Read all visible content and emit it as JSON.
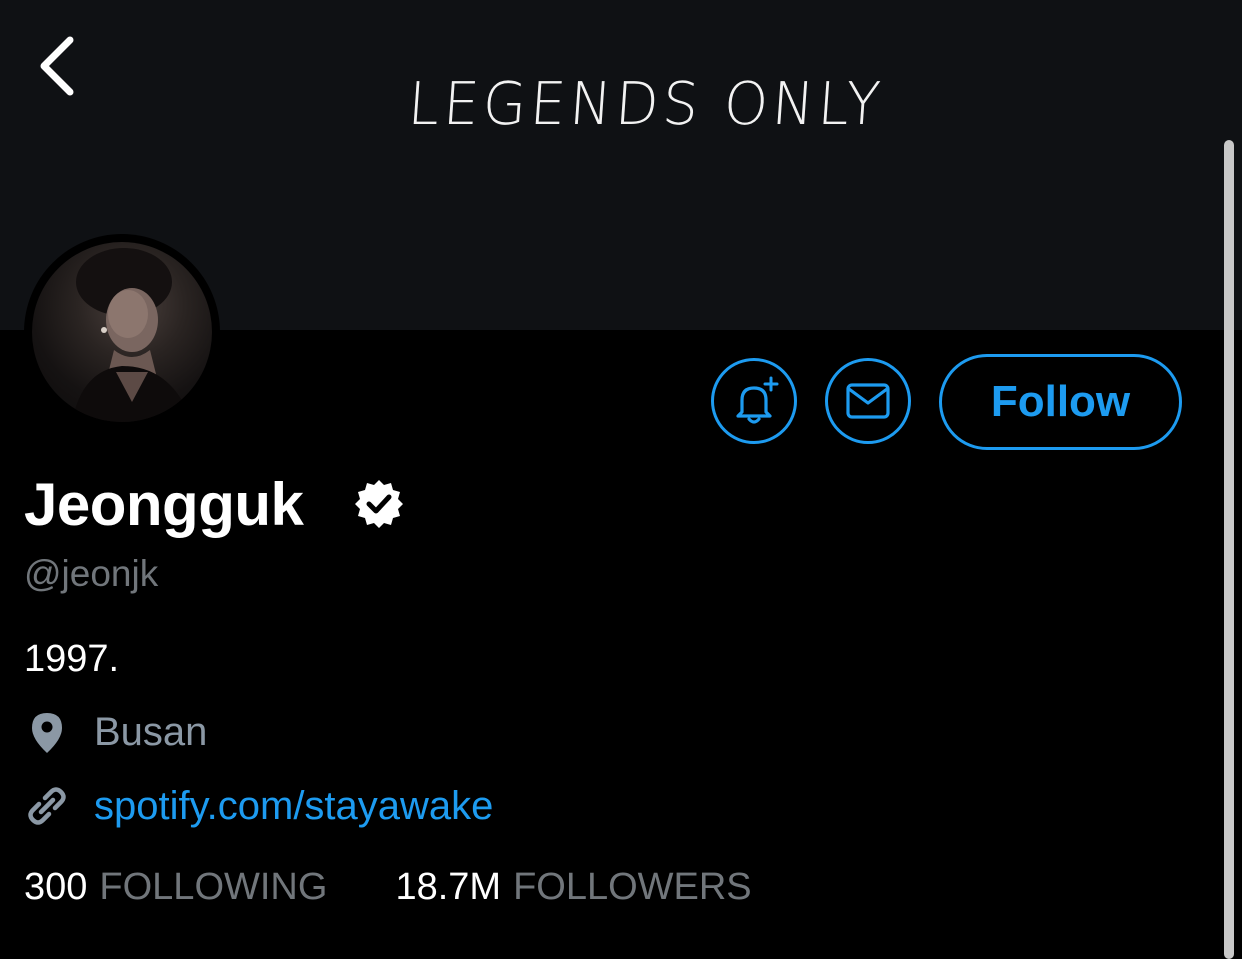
{
  "banner": {
    "text": "LEGENDS ONLY",
    "icon": "chevron-left-icon"
  },
  "profile": {
    "display_name": "Jeongguk",
    "handle": "@jeonjk",
    "bio": "1997.",
    "location": "Busan",
    "link": "spotify.com/stayawake",
    "verified": true
  },
  "actions": {
    "notify_icon": "bell-plus-icon",
    "message_icon": "envelope-icon",
    "follow_label": "Follow"
  },
  "stats": {
    "following_count": "300",
    "following_label": "FOLLOWING",
    "followers_count": "18.7M",
    "followers_label": "FOLLOWERS"
  },
  "colors": {
    "accent": "#1d9bf0",
    "background": "#000000",
    "banner": "#0f1114",
    "muted": "#71767b"
  }
}
